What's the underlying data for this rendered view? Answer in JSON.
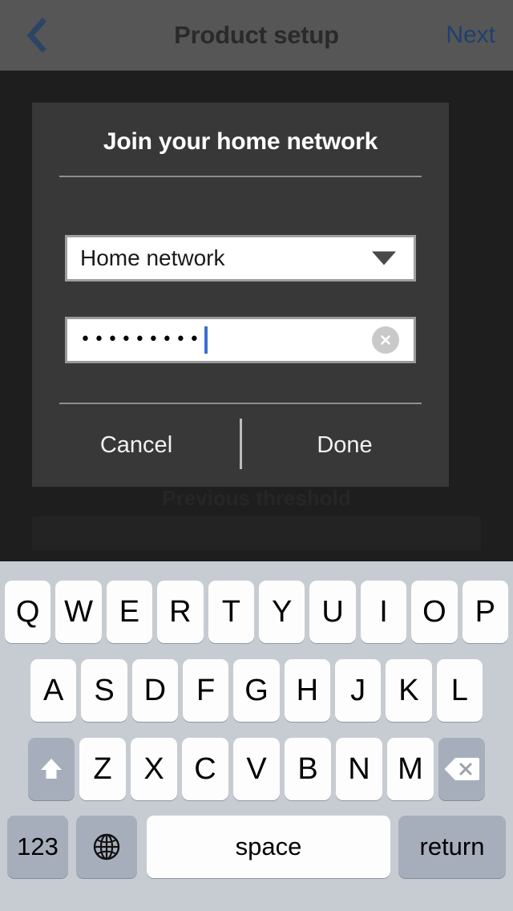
{
  "navbar": {
    "back_icon": "chevron-left-icon",
    "title": "Product setup",
    "next_label": "Next",
    "accent_color": "#1d4070",
    "background_color": "#565656"
  },
  "dialog": {
    "title": "Join your home network",
    "network_select": {
      "value": "Home network",
      "caret_icon": "chevron-down-icon"
    },
    "password_field": {
      "value": "•••••••••",
      "masked_char_count": 9,
      "clear_icon": "clear-circle-icon",
      "caret_color": "#3b6fd4"
    },
    "cancel_label": "Cancel",
    "done_label": "Done",
    "background_color": "#383838"
  },
  "backdrop": {
    "ghost_title": "Previous threshold"
  },
  "keyboard": {
    "background_color": "#c7ccd3",
    "row1": [
      "Q",
      "W",
      "E",
      "R",
      "T",
      "Y",
      "U",
      "I",
      "O",
      "P"
    ],
    "row2": [
      "A",
      "S",
      "D",
      "F",
      "G",
      "H",
      "J",
      "K",
      "L"
    ],
    "row3": [
      "Z",
      "X",
      "C",
      "V",
      "B",
      "N",
      "M"
    ],
    "shift_icon": "shift-arrow-icon",
    "backspace_icon": "backspace-icon",
    "numbers_label": "123",
    "globe_icon": "globe-icon",
    "space_label": "space",
    "return_label": "return"
  }
}
